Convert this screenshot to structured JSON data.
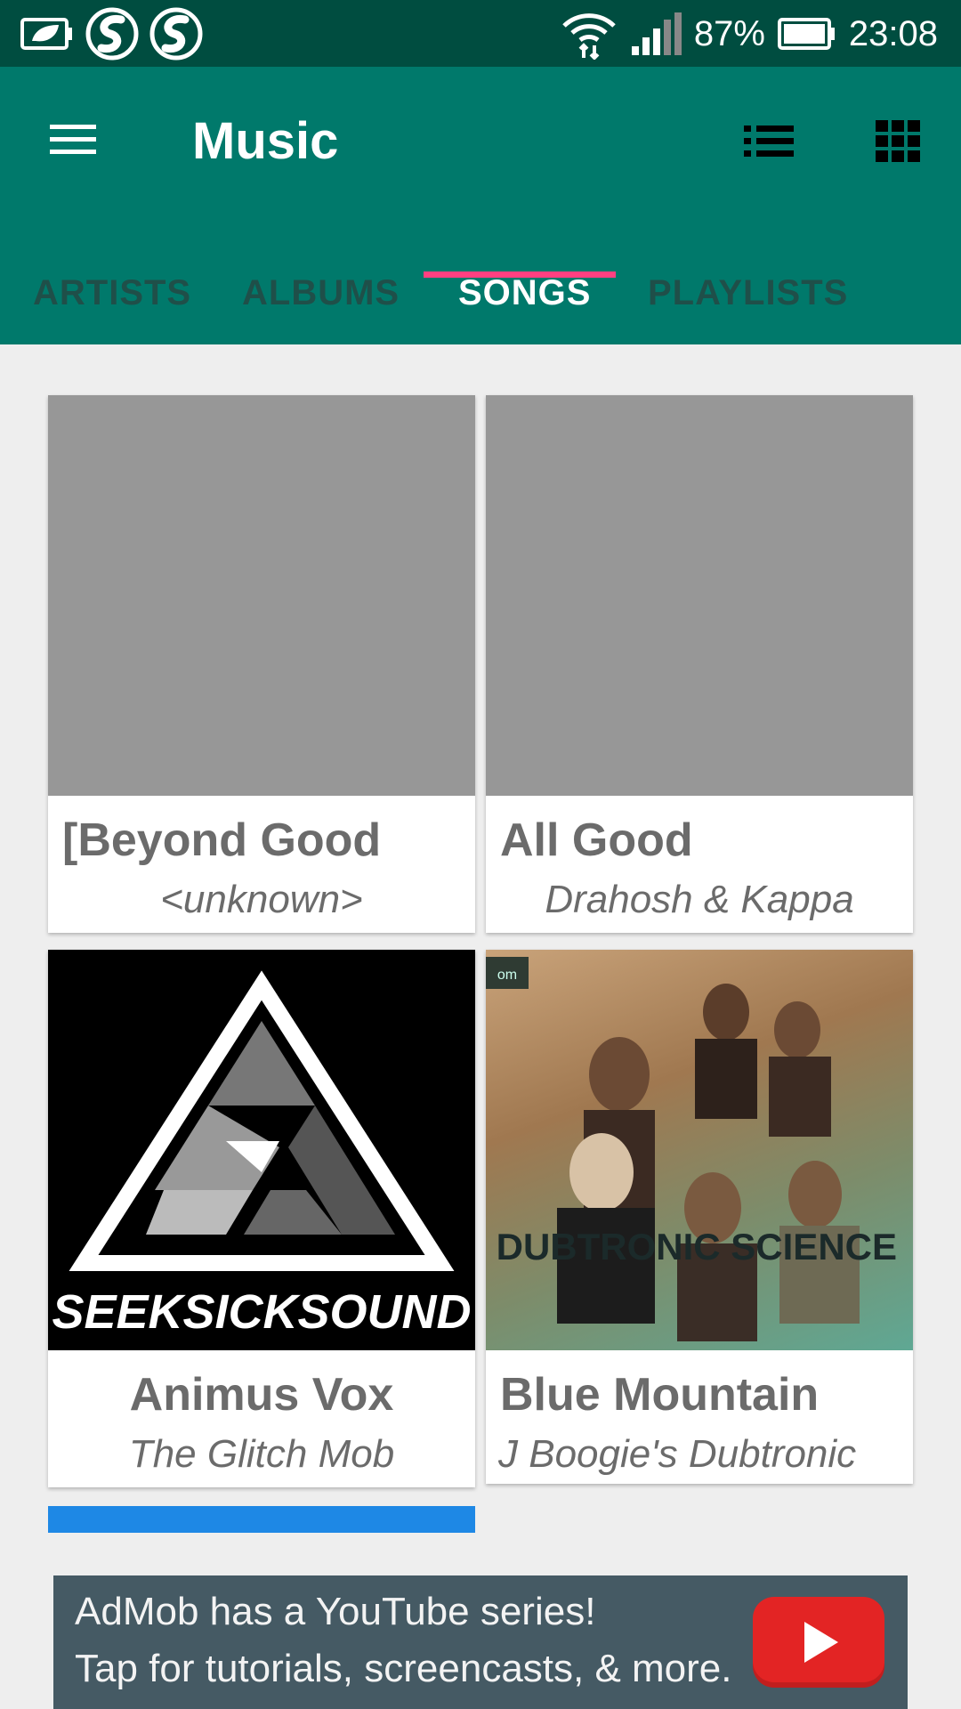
{
  "status_bar": {
    "battery_percent": "87%",
    "time": "23:08",
    "icons": [
      "battery-saver-icon",
      "app-s-icon",
      "app-s-icon",
      "wifi-icon",
      "signal-icon",
      "battery-icon"
    ]
  },
  "app_bar": {
    "title": "Music",
    "menu_icon": "hamburger-menu-icon",
    "list_view_icon": "list-view-icon",
    "grid_view_icon": "grid-view-icon"
  },
  "tabs": [
    {
      "label": "ARTISTS",
      "active": false
    },
    {
      "label": "ALBUMS",
      "active": false
    },
    {
      "label": "SONGS",
      "active": true
    },
    {
      "label": "PLAYLISTS",
      "active": false
    }
  ],
  "songs": [
    {
      "title": "[Beyond Good",
      "artist": "<unknown>",
      "art": "none"
    },
    {
      "title": "All Good",
      "artist": "Drahosh & Kappa",
      "art": "none"
    },
    {
      "title": "Animus Vox",
      "artist": "The Glitch Mob",
      "art": "seeksicksound-cover",
      "art_text": "SEEKSICKSOUND"
    },
    {
      "title": "Blue Mountain",
      "artist": "J Boogie's Dubtronic",
      "art": "j-boogie-cover",
      "art_text": "J BOOGIE'S DUBTRONIC SCIENCE",
      "art_badge": "om"
    }
  ],
  "ad": {
    "line1": "AdMob has a YouTube series!",
    "line2": "Tap for tutorials, screencasts, & more.",
    "icon": "youtube-play-icon"
  },
  "colors": {
    "status_bar": "#004d40",
    "app_bar": "#00796b",
    "tab_indicator": "#ff4081",
    "background": "#eeeeee",
    "ad_background": "#455a64"
  }
}
